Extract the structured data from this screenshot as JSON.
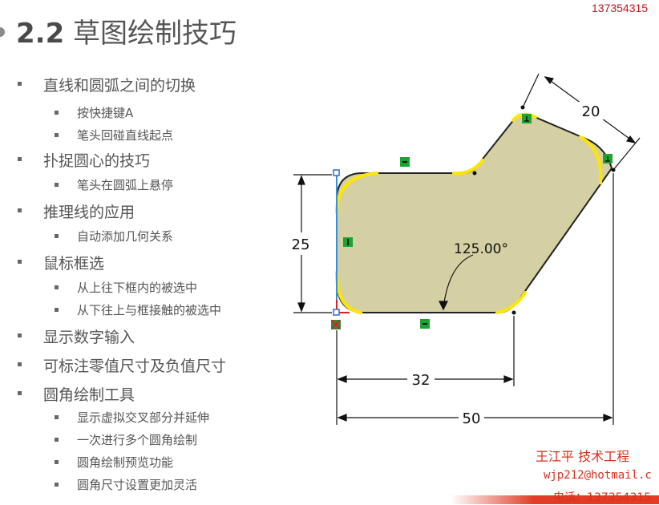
{
  "header": {
    "phone": "137354315",
    "title_number": "2.2",
    "title_text": "草图绘制技巧"
  },
  "bullets": [
    {
      "level": 1,
      "text": "直线和圆弧之间的切换"
    },
    {
      "level": 2,
      "text": "按快捷键A"
    },
    {
      "level": 2,
      "text": "笔头回碰直线起点"
    },
    {
      "level": 1,
      "text": "扑捉圆心的技巧"
    },
    {
      "level": 2,
      "text": "笔头在圆弧上悬停"
    },
    {
      "level": 1,
      "text": "推理线的应用"
    },
    {
      "level": 2,
      "text": "自动添加几何关系"
    },
    {
      "level": 1,
      "text": "鼠标框选"
    },
    {
      "level": 2,
      "text": "从上往下框内的被选中"
    },
    {
      "level": 2,
      "text": "从下往上与框接触的被选中"
    },
    {
      "level": 1,
      "text": "显示数字输入"
    },
    {
      "level": 1,
      "text": "可标注零值尺寸及负值尺寸"
    },
    {
      "level": 1,
      "text": "圆角绘制工具"
    },
    {
      "level": 2,
      "text": "显示虚拟交叉部分并延伸"
    },
    {
      "level": 2,
      "text": "一次进行多个圆角绘制"
    },
    {
      "level": 2,
      "text": "圆角绘制预览功能"
    },
    {
      "level": 2,
      "text": "圆角尺寸设置更加灵活"
    }
  ],
  "sketch": {
    "dim_top": "20",
    "dim_left": "25",
    "dim_angle": "125.00°",
    "dim_bottom_inner": "32",
    "dim_bottom_outer": "50",
    "fill_color": "#d4d0a3",
    "highlight_color": "#ffe600"
  },
  "contact": {
    "name": "王江平   技术工程",
    "email": "wjp212@hotmail.c",
    "phone": "电话：137354315"
  }
}
